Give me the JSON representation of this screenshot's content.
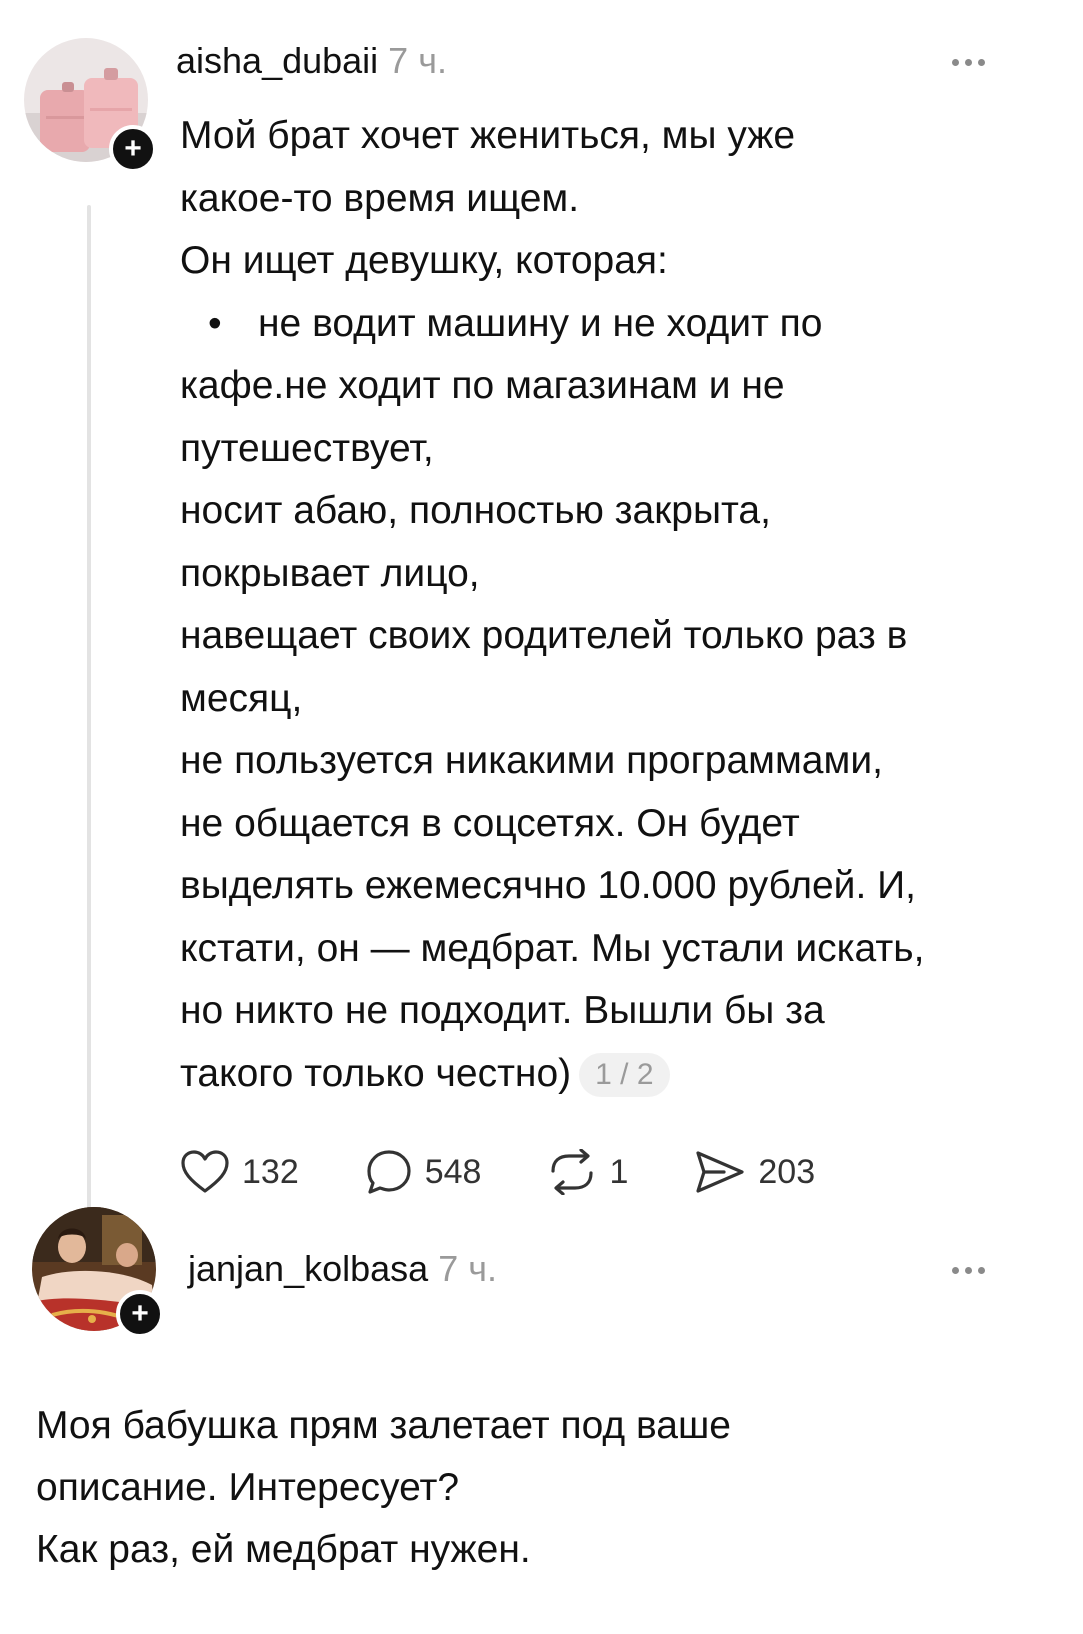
{
  "post": {
    "username": "aisha_dubaii",
    "time": "7 ч.",
    "avatar_icon": "luggage-avatar",
    "lines": [
      "Мой брат хочет жениться, мы уже",
      "какое-то время ищем.",
      "Он ищет девушку, которая:",
      "не водит машину и не ходит по",
      "кафе.не ходит по магазинам и не",
      "путешествует,",
      "носит абаю, полностью закрыта,",
      "покрывает лицо,",
      "навещает своих родителей только раз в",
      "месяц,",
      "не пользуется никакими программами,",
      "не общается в соцсетях. Он будет",
      "выделять ежемесячно 10.000 рублей. И,",
      "кстати, он — медбрат. Мы устали искать,",
      "но никто не подходит. Вышли бы за",
      "такого только честно)"
    ],
    "bullet": "•",
    "page_indicator": "1 / 2",
    "actions": {
      "likes": "132",
      "comments": "548",
      "reposts": "1",
      "shares": "203"
    }
  },
  "reply": {
    "username": "janjan_kolbasa",
    "time": "7 ч.",
    "avatar_icon": "painting-avatar",
    "lines": [
      "Моя бабушка прям залетает под ваше",
      "описание. Интересует?",
      "Как раз, ей медбрат нужен."
    ]
  },
  "icons": {
    "follow": "+",
    "heart": "heart-icon",
    "comment": "comment-icon",
    "repost": "repost-icon",
    "share": "share-icon",
    "more": "more-icon"
  }
}
